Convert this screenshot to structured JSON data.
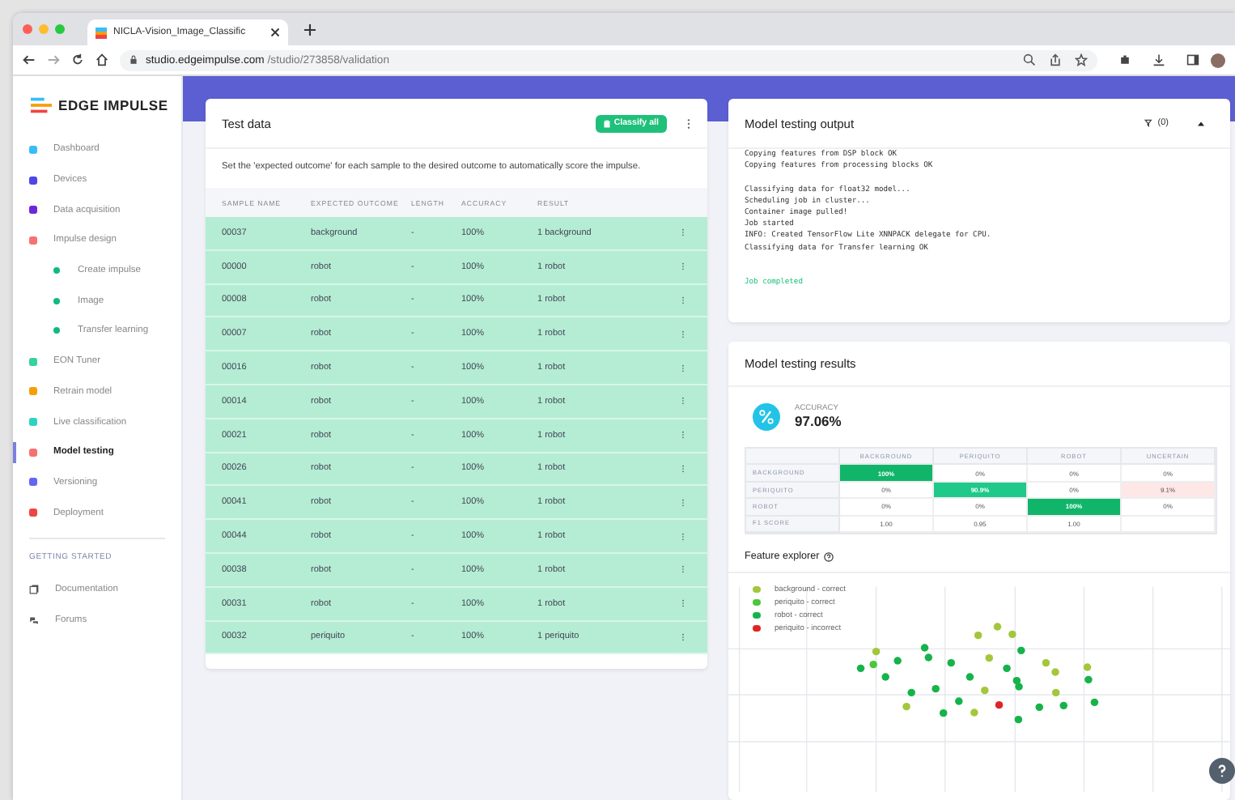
{
  "browser": {
    "tab_title": "NICLA-Vision_Image_Classific",
    "url_host": "studio.edgeimpulse.com",
    "url_path": "/studio/273858/validation"
  },
  "sidebar": {
    "logo": "EDGE IMPULSE",
    "items": [
      {
        "label": "Dashboard",
        "color": "#38bdf8",
        "selected": false
      },
      {
        "label": "Devices",
        "color": "#4f46e5",
        "selected": false
      },
      {
        "label": "Data acquisition",
        "color": "#6d28d9",
        "selected": false
      },
      {
        "label": "Impulse design",
        "color": "#f87171",
        "selected": false,
        "children": [
          {
            "label": "Create impulse",
            "color": "#10b981",
            "selected": false
          },
          {
            "label": "Image",
            "color": "#10b981",
            "selected": false
          },
          {
            "label": "Transfer learning",
            "color": "#10b981",
            "selected": false
          }
        ]
      },
      {
        "label": "EON Tuner",
        "color": "#34d399",
        "selected": false
      },
      {
        "label": "Retrain model",
        "color": "#f59e0b",
        "selected": false
      },
      {
        "label": "Live classification",
        "color": "#2dd4bf",
        "selected": false
      },
      {
        "label": "Model testing",
        "color": "#f87171",
        "selected": true
      },
      {
        "label": "Versioning",
        "color": "#6366f1",
        "selected": false
      },
      {
        "label": "Deployment",
        "color": "#ef4444",
        "selected": false
      }
    ],
    "section": "GETTING STARTED",
    "links": [
      {
        "label": "Documentation"
      },
      {
        "label": "Forums"
      }
    ]
  },
  "test_data": {
    "title": "Test data",
    "button": "Classify all",
    "description": "Set the 'expected outcome' for each sample to the desired outcome to automatically score the impulse.",
    "columns": [
      "SAMPLE NAME",
      "EXPECTED OUTCOME",
      "LENGTH",
      "ACCURACY",
      "RESULT"
    ],
    "rows": [
      {
        "name": "00037",
        "expected": "background",
        "length": "-",
        "accuracy": "100%",
        "result": "1 background",
        "correct": true
      },
      {
        "name": "00000",
        "expected": "robot",
        "length": "-",
        "accuracy": "100%",
        "result": "1 robot",
        "correct": true
      },
      {
        "name": "00008",
        "expected": "robot",
        "length": "-",
        "accuracy": "100%",
        "result": "1 robot",
        "correct": true
      },
      {
        "name": "00007",
        "expected": "robot",
        "length": "-",
        "accuracy": "100%",
        "result": "1 robot",
        "correct": true
      },
      {
        "name": "00016",
        "expected": "robot",
        "length": "-",
        "accuracy": "100%",
        "result": "1 robot",
        "correct": true
      },
      {
        "name": "00014",
        "expected": "robot",
        "length": "-",
        "accuracy": "100%",
        "result": "1 robot",
        "correct": true
      },
      {
        "name": "00021",
        "expected": "robot",
        "length": "-",
        "accuracy": "100%",
        "result": "1 robot",
        "correct": true
      },
      {
        "name": "00026",
        "expected": "robot",
        "length": "-",
        "accuracy": "100%",
        "result": "1 robot",
        "correct": true
      },
      {
        "name": "00041",
        "expected": "robot",
        "length": "-",
        "accuracy": "100%",
        "result": "1 robot",
        "correct": true
      },
      {
        "name": "00044",
        "expected": "robot",
        "length": "-",
        "accuracy": "100%",
        "result": "1 robot",
        "correct": true
      },
      {
        "name": "00038",
        "expected": "robot",
        "length": "-",
        "accuracy": "100%",
        "result": "1 robot",
        "correct": true
      },
      {
        "name": "00031",
        "expected": "robot",
        "length": "-",
        "accuracy": "100%",
        "result": "1 robot",
        "correct": true
      },
      {
        "name": "00032",
        "expected": "periquito",
        "length": "-",
        "accuracy": "100%",
        "result": "1 periquito",
        "correct": true
      }
    ]
  },
  "output": {
    "title": "Model testing output",
    "count": "(0)",
    "log": [
      [
        "Copying features from DSP block OK",
        "Copying features from processing blocks OK"
      ],
      [
        "Classifying data for float32 model...",
        "Scheduling job in cluster...",
        "Container image pulled!",
        "Job started",
        "INFO: Created TensorFlow Lite XNNPACK delegate for CPU.",
        "Classifying data for Transfer learning OK"
      ]
    ],
    "status": "Job completed"
  },
  "results": {
    "title": "Model testing results",
    "accuracy_label": "ACCURACY",
    "accuracy": "97.06%",
    "matrix": {
      "columns": [
        "BACKGROUND",
        "PERIQUITO",
        "ROBOT",
        "UNCERTAIN"
      ],
      "rows": [
        {
          "label": "BACKGROUND",
          "cells": [
            {
              "text": "100%",
              "kind": "correct"
            },
            {
              "text": "0%",
              "kind": "plain"
            },
            {
              "text": "0%",
              "kind": "plain"
            },
            {
              "text": "0%",
              "kind": "plain"
            }
          ]
        },
        {
          "label": "PERIQUITO",
          "cells": [
            {
              "text": "0%",
              "kind": "plain"
            },
            {
              "text": "90.9%",
              "kind": "partial"
            },
            {
              "text": "0%",
              "kind": "plain"
            },
            {
              "text": "9.1%",
              "kind": "wrong"
            }
          ]
        },
        {
          "label": "ROBOT",
          "cells": [
            {
              "text": "0%",
              "kind": "plain"
            },
            {
              "text": "0%",
              "kind": "plain"
            },
            {
              "text": "100%",
              "kind": "correct"
            },
            {
              "text": "0%",
              "kind": "plain"
            }
          ]
        },
        {
          "label": "F1 SCORE",
          "cells": [
            {
              "text": "1.00",
              "kind": "plain"
            },
            {
              "text": "0.95",
              "kind": "plain"
            },
            {
              "text": "1.00",
              "kind": "plain"
            },
            {
              "text": "",
              "kind": "plain"
            }
          ]
        }
      ]
    },
    "explorer_title": "Feature explorer",
    "legend": [
      {
        "label": "background - correct",
        "color": "#a3c73a"
      },
      {
        "label": "periquito - correct",
        "color": "#4cc63a"
      },
      {
        "label": "robot - correct",
        "color": "#16b34a"
      },
      {
        "label": "periquito - incorrect",
        "color": "#e02424"
      }
    ]
  }
}
